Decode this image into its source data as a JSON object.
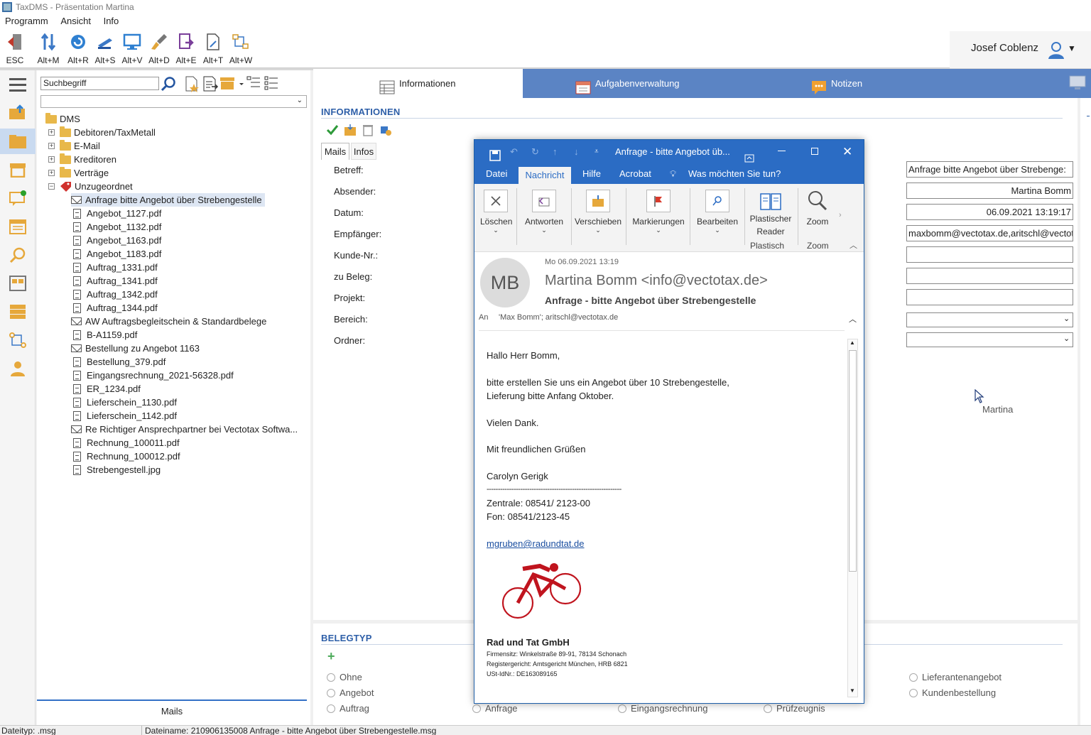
{
  "app": {
    "title": "TaxDMS - Präsentation Martina"
  },
  "menu": [
    "Programm",
    "Ansicht",
    "Info"
  ],
  "toolbar": [
    {
      "label": "ESC",
      "icon": "exit-icon"
    },
    {
      "label": "Alt+M",
      "icon": "arrows-icon"
    },
    {
      "label": "Alt+R",
      "icon": "refresh-icon"
    },
    {
      "label": "Alt+S",
      "icon": "scanner-icon"
    },
    {
      "label": "Alt+V",
      "icon": "monitor-icon"
    },
    {
      "label": "Alt+D",
      "icon": "brush-icon"
    },
    {
      "label": "Alt+E",
      "icon": "export-icon"
    },
    {
      "label": "Alt+T",
      "icon": "template-icon"
    },
    {
      "label": "Alt+W",
      "icon": "workflow-icon"
    }
  ],
  "user": {
    "name": "Josef Coblenz"
  },
  "search": {
    "placeholder": "Suchbegriff"
  },
  "tree": {
    "root": "DMS",
    "groups": [
      "Debitoren/TaxMetall",
      "E-Mail",
      "Kreditoren",
      "Verträge",
      "Unzugeordnet"
    ],
    "items": [
      {
        "label": "Anfrage  bitte Angebot über Strebengestelle",
        "type": "mail",
        "selected": true
      },
      {
        "label": "Angebot_1127.pdf",
        "type": "doc"
      },
      {
        "label": "Angebot_1132.pdf",
        "type": "doc"
      },
      {
        "label": "Angebot_1163.pdf",
        "type": "doc"
      },
      {
        "label": "Angebot_1183.pdf",
        "type": "doc"
      },
      {
        "label": "Auftrag_1331.pdf",
        "type": "doc"
      },
      {
        "label": "Auftrag_1341.pdf",
        "type": "doc"
      },
      {
        "label": "Auftrag_1342.pdf",
        "type": "doc"
      },
      {
        "label": "Auftrag_1344.pdf",
        "type": "doc"
      },
      {
        "label": "AW Auftragsbegleitschein & Standardbelege",
        "type": "mail"
      },
      {
        "label": "B-A1159.pdf",
        "type": "doc"
      },
      {
        "label": "Bestellung zu Angebot 1163",
        "type": "mail"
      },
      {
        "label": "Bestellung_379.pdf",
        "type": "doc"
      },
      {
        "label": "Eingangsrechnung_2021-56328.pdf",
        "type": "doc"
      },
      {
        "label": "ER_1234.pdf",
        "type": "doc"
      },
      {
        "label": "Lieferschein_1130.pdf",
        "type": "doc"
      },
      {
        "label": "Lieferschein_1142.pdf",
        "type": "doc"
      },
      {
        "label": "Re Richtiger Ansprechpartner bei Vectotax Softwa...",
        "type": "mail"
      },
      {
        "label": "Rechnung_100011.pdf",
        "type": "doc"
      },
      {
        "label": "Rechnung_100012.pdf",
        "type": "doc"
      },
      {
        "label": "Strebengestell.jpg",
        "type": "doc"
      }
    ],
    "footer_button": "Mails"
  },
  "tabs": [
    "Informationen",
    "Aufgabenverwaltung",
    "Notizen"
  ],
  "info": {
    "heading": "INFORMATIONEN",
    "subtabs": [
      "Mails",
      "Infos"
    ],
    "labels": [
      "Betreff:",
      "Absender:",
      "Datum:",
      "Empfänger:",
      "Kunde-Nr.:",
      "zu Beleg:",
      "Projekt:",
      "Bereich:",
      "Ordner:"
    ],
    "values": [
      "Anfrage  bitte Angebot über Strebenge:",
      "Martina Bomm",
      "06.09.2021 13:19:17",
      "maxbomm@vectotax.de,aritschl@vectot",
      "",
      "",
      "",
      "",
      ""
    ],
    "note": "Martina"
  },
  "belegtyp": {
    "heading": "BELEGTYP",
    "options": [
      "Ohne",
      "Angebot",
      "Auftrag",
      "Anfrage",
      "Eingangsrechnung",
      "Prüfzeugnis",
      "Lieferantenangebot",
      "Kundenbestellung"
    ]
  },
  "status": {
    "left": "Dateityp: .msg",
    "right": "Dateiname: 210906135008 Anfrage - bitte Angebot über Strebengestelle.msg"
  },
  "outlook": {
    "title": "Anfrage - bitte Angebot üb...",
    "menu_tabs": [
      "Datei",
      "Nachricht",
      "Hilfe",
      "Acrobat"
    ],
    "tellme": "Was möchten Sie tun?",
    "ribbon": [
      "Löschen",
      "Antworten",
      "Verschieben",
      "Markierungen",
      "Bearbeiten",
      "Plastischer Reader",
      "Zoom"
    ],
    "ribbon_groups": [
      "Plastisch",
      "Zoom"
    ],
    "avatar": "MB",
    "date": "Mo 06.09.2021 13:19",
    "from": "Martina Bomm <info@vectotax.de>",
    "subject": "Anfrage - bitte Angebot über Strebengestelle",
    "to_label": "An",
    "to": "'Max Bomm'; aritschl@vectotax.de",
    "body": {
      "greeting": "Hallo Herr Bomm,",
      "line1": "bitte erstellen Sie uns ein Angebot über 10 Strebengestelle,",
      "line2": "Lieferung bitte Anfang Oktober.",
      "thanks": "Vielen Dank.",
      "regards": "Mit freundlichen Grüßen",
      "name": "Carolyn Gerigk",
      "separator": "------------------------------------------------------------",
      "phone1": "Zentrale: 08541/ 2123-00",
      "phone2": "Fon: 08541/2123-45",
      "email": "mgruben@radundtat.de",
      "company": "Rad und Tat GmbH",
      "addr1": "Firmensitz: Winkelstraße 89-91, 78134 Schonach",
      "addr2": "Registergericht: Amtsgericht München, HRB 6821",
      "addr3": "USt-IdNr.: DE163089165"
    }
  },
  "colors": {
    "accent": "#2e5fa8",
    "tabbar": "#5b84c4",
    "outlook": "#2b6cc4",
    "logo": "#c0141e"
  }
}
